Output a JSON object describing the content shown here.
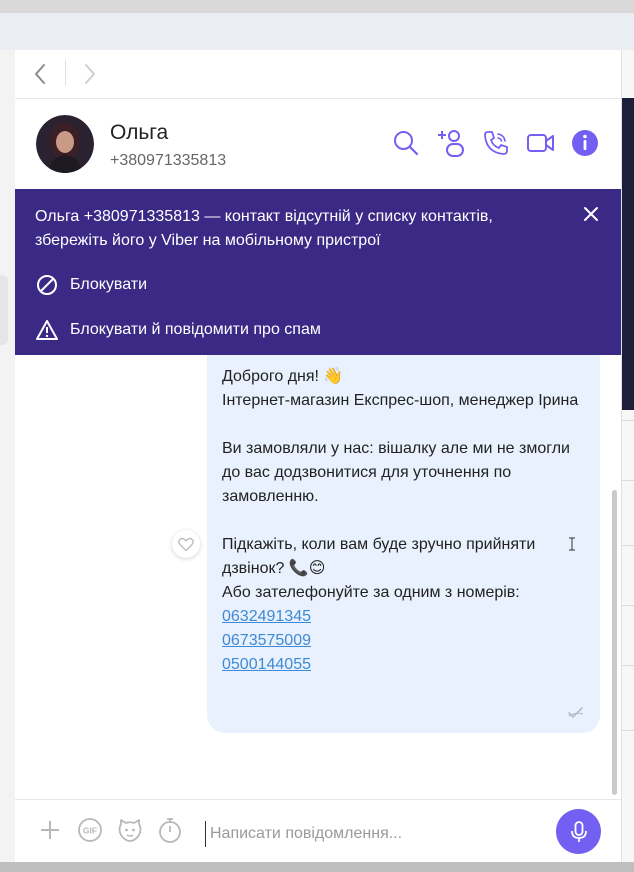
{
  "contact": {
    "name": "Ольга",
    "phone": "+380971335813"
  },
  "banner": {
    "message": "Ольга +380971335813 — контакт відсутній у списку контактів, збережіть його у Viber на мобільному пристрої",
    "block_label": "Блокувати",
    "block_report_label": "Блокувати й повідомити про спам"
  },
  "message": {
    "line1": "Доброго дня! 👋",
    "line2": "Інтернет-магазин Експрес-шоп, менеджер Ірина",
    "line3": "Ви замовляли у нас: вішалку але ми не змогли до вас додзвонитися для уточнення по замовленню.",
    "line4": "Підкажіть, коли вам буде зручно прийняти дзвінок? 📞😊",
    "line5": "Або зателефонуйте за одним з номерів:",
    "phones": [
      "0632491345",
      "0673575009",
      "0500144055"
    ]
  },
  "composer": {
    "placeholder": "Написати повідомлення..."
  },
  "icons": {
    "nav": [
      "back-arrow-icon",
      "forward-arrow-icon"
    ],
    "header": [
      "search-icon",
      "add-participant-icon",
      "call-icon",
      "video-call-icon",
      "info-icon"
    ],
    "banner": [
      "close-icon",
      "block-icon",
      "warning-icon"
    ],
    "composer": [
      "plus-icon",
      "gif-icon",
      "sticker-icon",
      "timer-icon",
      "microphone-icon"
    ]
  },
  "colors": {
    "accent": "#7360f2",
    "banner": "#3b2a85",
    "bubble": "#e8f1fd",
    "link": "#3e8ad6"
  }
}
